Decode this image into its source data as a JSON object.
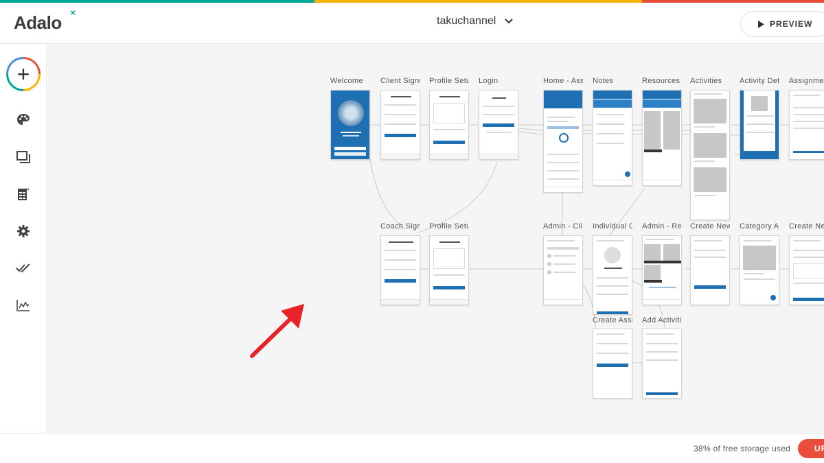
{
  "brand": {
    "logo_text": "Adalo",
    "stripe_colors": [
      "#00a898",
      "#f5b400",
      "#e94e3c"
    ]
  },
  "header": {
    "app_name": "takuchannel",
    "preview_label": "PREVIEW"
  },
  "sidebar": {
    "items": [
      {
        "name": "add-component-icon"
      },
      {
        "name": "palette-icon"
      },
      {
        "name": "screens-icon"
      },
      {
        "name": "database-icon"
      },
      {
        "name": "settings-icon"
      },
      {
        "name": "publish-icon"
      },
      {
        "name": "analytics-icon"
      }
    ]
  },
  "canvas": {
    "screens": [
      {
        "label": "Welcome",
        "type": "welcome"
      },
      {
        "label": "Client Signu",
        "type": "form"
      },
      {
        "label": "Profile Setu",
        "type": "form"
      },
      {
        "label": "Login",
        "type": "form"
      },
      {
        "label": "Home - Ass",
        "type": "home"
      },
      {
        "label": "Notes",
        "type": "list"
      },
      {
        "label": "Resources",
        "type": "grid"
      },
      {
        "label": "Activities",
        "type": "images"
      },
      {
        "label": "Activity Det",
        "type": "detail"
      },
      {
        "label": "Assignmer",
        "type": "list"
      },
      {
        "label": "Coach Signi",
        "type": "form"
      },
      {
        "label": "Profile Setu",
        "type": "form"
      },
      {
        "label": "Admin - Cli",
        "type": "list"
      },
      {
        "label": "Individual C",
        "type": "profile"
      },
      {
        "label": "Admin - Re",
        "type": "grid"
      },
      {
        "label": "Create New",
        "type": "form"
      },
      {
        "label": "Category Ac",
        "type": "images"
      },
      {
        "label": "Create New",
        "type": "form"
      },
      {
        "label": "Create Assi",
        "type": "form"
      },
      {
        "label": "Add Activiti",
        "type": "list"
      }
    ]
  },
  "footer": {
    "storage_text": "38% of free storage used",
    "upgrade_label": "UPGRADE"
  },
  "colors": {
    "accent": "#1f6fb3",
    "upgrade": "#e94e3c",
    "arrow": "#e8242b"
  }
}
